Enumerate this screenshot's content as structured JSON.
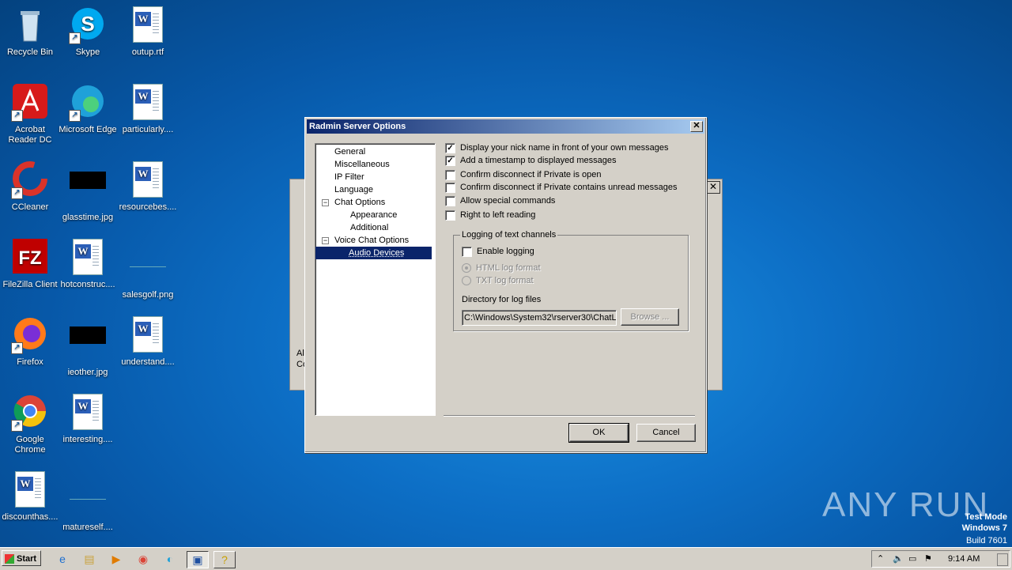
{
  "desktop": {
    "icons": [
      {
        "label": "Recycle Bin",
        "icon": "recycle-bin-icon"
      },
      {
        "label": "Skype",
        "icon": "skype-icon"
      },
      {
        "label": "outup.rtf",
        "icon": "word-doc-icon"
      },
      {
        "label": "Acrobat Reader DC",
        "icon": "acrobat-icon"
      },
      {
        "label": "Microsoft Edge",
        "icon": "edge-icon"
      },
      {
        "label": "particularly....",
        "icon": "word-doc-icon"
      },
      {
        "label": "CCleaner",
        "icon": "ccleaner-icon"
      },
      {
        "label": "glasstime.jpg",
        "icon": "image-icon"
      },
      {
        "label": "resourcebes....",
        "icon": "word-doc-icon"
      },
      {
        "label": "FileZilla Client",
        "icon": "filezilla-icon"
      },
      {
        "label": "hotconstruc....",
        "icon": "word-doc-icon"
      },
      {
        "label": "salesgolf.png",
        "icon": "image-icon"
      },
      {
        "label": "Firefox",
        "icon": "firefox-icon"
      },
      {
        "label": "ieother.jpg",
        "icon": "image-icon"
      },
      {
        "label": "understand....",
        "icon": "word-doc-icon"
      },
      {
        "label": "Google Chrome",
        "icon": "chrome-icon"
      },
      {
        "label": "interesting....",
        "icon": "word-doc-icon"
      },
      {
        "label": "discounthas....",
        "icon": "word-doc-icon"
      },
      {
        "label": "matureself....",
        "icon": "image-icon"
      }
    ]
  },
  "dialog": {
    "title": "Radmin Server Options",
    "close_glyph": "✕",
    "tree": [
      {
        "label": "General",
        "level": 0
      },
      {
        "label": "Miscellaneous",
        "level": 0
      },
      {
        "label": "IP Filter",
        "level": 0
      },
      {
        "label": "Language",
        "level": 0
      },
      {
        "label": "Chat Options",
        "level": 0,
        "expander": "−"
      },
      {
        "label": "Appearance",
        "level": 1
      },
      {
        "label": "Additional",
        "level": 1
      },
      {
        "label": "Voice Chat Options",
        "level": 0,
        "expander": "−"
      },
      {
        "label": "Audio Devices",
        "level": 1,
        "selected": true
      }
    ],
    "options": [
      {
        "label": "Display your nick name in front of your own messages",
        "checked": true
      },
      {
        "label": "Add a timestamp to displayed messages",
        "checked": true
      },
      {
        "label": "Confirm disconnect if Private is open",
        "checked": false
      },
      {
        "label": "Confirm disconnect if Private contains unread messages",
        "checked": false
      },
      {
        "label": "Allow special commands",
        "checked": false
      },
      {
        "label": "Right to left reading",
        "checked": false
      }
    ],
    "logging": {
      "group_title": "Logging of text channels",
      "enable_label": "Enable logging",
      "enable_checked": false,
      "html_label": "HTML log format",
      "txt_label": "TXT log format",
      "dir_label": "Directory for log files",
      "dir_value": "C:\\Windows\\System32\\rserver30\\ChatL",
      "browse_label": "Browse ..."
    },
    "ok_label": "OK",
    "cancel_label": "Cancel"
  },
  "back_dialog": {
    "close_glyph": "✕",
    "fragment_1": "Al",
    "fragment_2": "Co"
  },
  "taskbar": {
    "start_label": "Start",
    "clock": "9:14 AM"
  },
  "watermark": {
    "brand": "ANY RUN",
    "line1": "Test Mode",
    "line2": "Windows 7",
    "line3": "Build 7601"
  }
}
